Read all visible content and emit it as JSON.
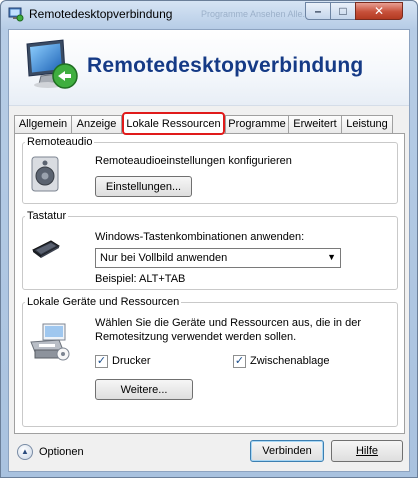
{
  "window": {
    "title": "Remotedesktopverbindung",
    "background_hint": "Programme  Ansehen  Alle...",
    "min_symbol": "–",
    "max_symbol": "□",
    "close_symbol": "✕"
  },
  "banner": {
    "title": "Remotedesktopverbindung",
    "logo_icon": "monitor-remote-icon"
  },
  "tabs": [
    {
      "label": "Allgemein"
    },
    {
      "label": "Anzeige"
    },
    {
      "label": "Lokale Ressourcen"
    },
    {
      "label": "Programme"
    },
    {
      "label": "Erweitert"
    },
    {
      "label": "Leistung"
    }
  ],
  "remoteaudio": {
    "legend": "Remoteaudio",
    "description": "Remoteaudioeinstellungen konfigurieren",
    "button_label": "Einstellungen...",
    "icon": "speaker-icon"
  },
  "tastatur": {
    "legend": "Tastatur",
    "description": "Windows-Tastenkombinationen anwenden:",
    "select_value": "Nur bei Vollbild anwenden",
    "example": "Beispiel: ALT+TAB",
    "icon": "keyboard-icon"
  },
  "lokale_geraete": {
    "legend": "Lokale Geräte und Ressourcen",
    "description_line1": "Wählen Sie die Geräte und Ressourcen aus, die in der",
    "description_line2": "Remotesitzung verwendet werden sollen.",
    "drucker_label": "Drucker",
    "zwischenablage_label": "Zwischenablage",
    "more_button": "Weitere...",
    "icon": "devices-icon",
    "drucker_checked": true,
    "zwischenablage_checked": true,
    "check_mark": "✓"
  },
  "footer": {
    "options_label": "Optionen",
    "options_arrow": "▲",
    "connect_label": "Verbinden",
    "help_label": "Hilfe"
  }
}
